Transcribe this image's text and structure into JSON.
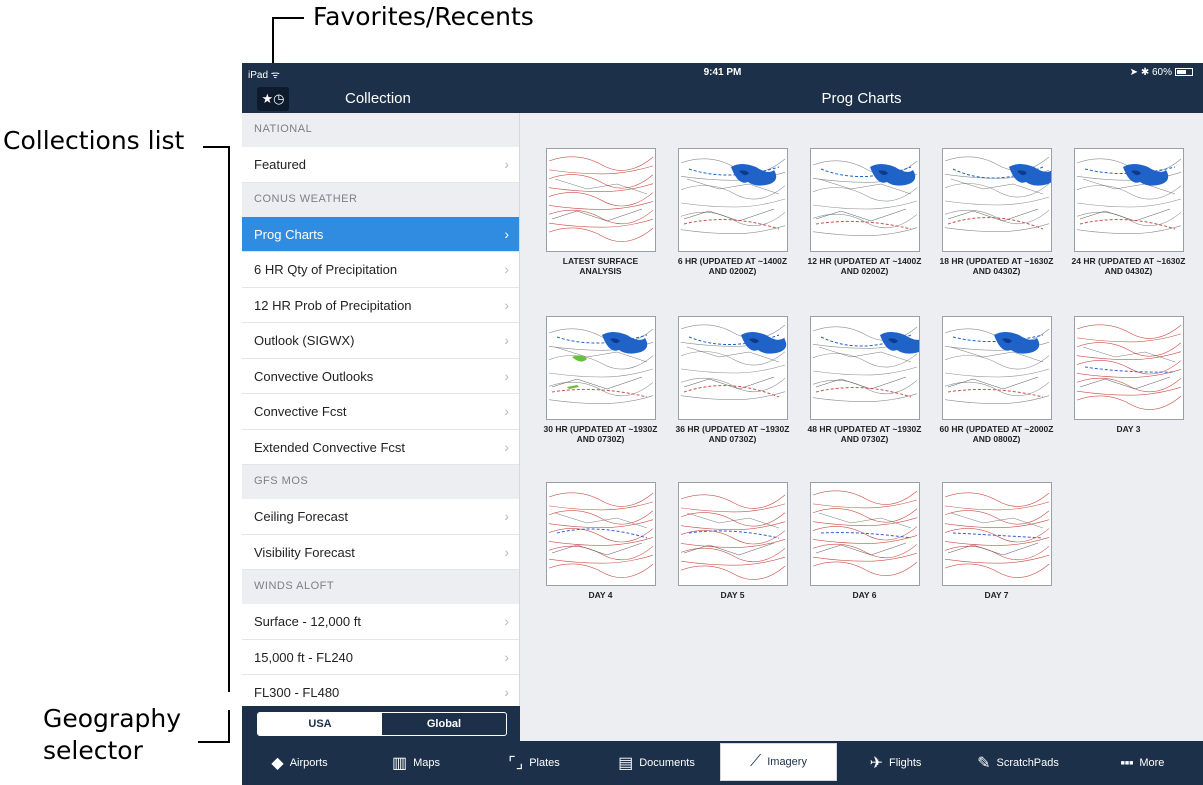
{
  "annotations": {
    "favorites": "Favorites/Recents",
    "collections": "Collections list",
    "geography_line1": "Geography",
    "geography_line2": "selector"
  },
  "status_bar": {
    "device": "iPad",
    "time": "9:41 PM",
    "battery": "60%"
  },
  "nav": {
    "left_title": "Collection",
    "title": "Prog Charts",
    "fav_icon": "star-clock-icon"
  },
  "sidebar": {
    "rows": [
      {
        "kind": "section",
        "label": "NATIONAL"
      },
      {
        "kind": "item",
        "label": "Featured"
      },
      {
        "kind": "section",
        "label": "CONUS WEATHER"
      },
      {
        "kind": "item",
        "label": "Prog Charts",
        "active": true
      },
      {
        "kind": "item",
        "label": "6 HR Qty of Precipitation"
      },
      {
        "kind": "item",
        "label": "12 HR Prob of Precipitation"
      },
      {
        "kind": "item",
        "label": "Outlook (SIGWX)"
      },
      {
        "kind": "item",
        "label": "Convective Outlooks"
      },
      {
        "kind": "item",
        "label": "Convective Fcst"
      },
      {
        "kind": "item",
        "label": "Extended Convective Fcst"
      },
      {
        "kind": "section",
        "label": "GFS MOS"
      },
      {
        "kind": "item",
        "label": "Ceiling Forecast"
      },
      {
        "kind": "item",
        "label": "Visibility Forecast"
      },
      {
        "kind": "section",
        "label": "WINDS ALOFT"
      },
      {
        "kind": "item",
        "label": "Surface - 12,000 ft"
      },
      {
        "kind": "item",
        "label": "15,000 ft - FL240"
      },
      {
        "kind": "item",
        "label": "FL300 - FL480"
      }
    ]
  },
  "geography": {
    "options": [
      "USA",
      "Global"
    ],
    "selected": "USA"
  },
  "charts": [
    {
      "caption": "LATEST SURFACE ANALYSIS",
      "style": "surface"
    },
    {
      "caption": "6 HR (UPDATED AT ~1400Z AND 0200Z)",
      "style": "precip"
    },
    {
      "caption": "12 HR (UPDATED AT ~1400Z AND 0200Z)",
      "style": "precip"
    },
    {
      "caption": "18 HR (UPDATED AT ~1630Z AND 0430Z)",
      "style": "precip"
    },
    {
      "caption": "24 HR (UPDATED AT ~1630Z AND 0430Z)",
      "style": "precip"
    },
    {
      "caption": "30 HR (UPDATED AT ~1930Z AND 0730Z)",
      "style": "precip-green"
    },
    {
      "caption": "36 HR (UPDATED AT ~1930Z AND 0730Z)",
      "style": "precip"
    },
    {
      "caption": "48 HR (UPDATED AT ~1930Z AND 0730Z)",
      "style": "precip"
    },
    {
      "caption": "60 HR (UPDATED AT ~2000Z AND 0800Z)",
      "style": "precip"
    },
    {
      "caption": "DAY 3",
      "style": "extended"
    },
    {
      "caption": "DAY 4",
      "style": "extended"
    },
    {
      "caption": "DAY 5",
      "style": "extended"
    },
    {
      "caption": "DAY 6",
      "style": "extended"
    },
    {
      "caption": "DAY 7",
      "style": "extended"
    }
  ],
  "tabs": [
    {
      "label": "Airports",
      "icon": "airport-diamond-icon",
      "glyph": "◆"
    },
    {
      "label": "Maps",
      "icon": "map-icon",
      "glyph": "▥"
    },
    {
      "label": "Plates",
      "icon": "plate-icon",
      "glyph": "⌜⌟"
    },
    {
      "label": "Documents",
      "icon": "documents-icon",
      "glyph": "▤"
    },
    {
      "label": "Imagery",
      "icon": "imagery-chart-icon",
      "glyph": "⟋",
      "active": true
    },
    {
      "label": "Flights",
      "icon": "flights-plane-icon",
      "glyph": "✈"
    },
    {
      "label": "ScratchPads",
      "icon": "pencil-icon",
      "glyph": "✎"
    },
    {
      "label": "More",
      "icon": "more-dots-icon",
      "glyph": "■■■"
    }
  ],
  "colors": {
    "nav": "#1c3049",
    "active": "#2f8ce0",
    "precip": "#1f63c9",
    "isobar": "#c9504a"
  }
}
